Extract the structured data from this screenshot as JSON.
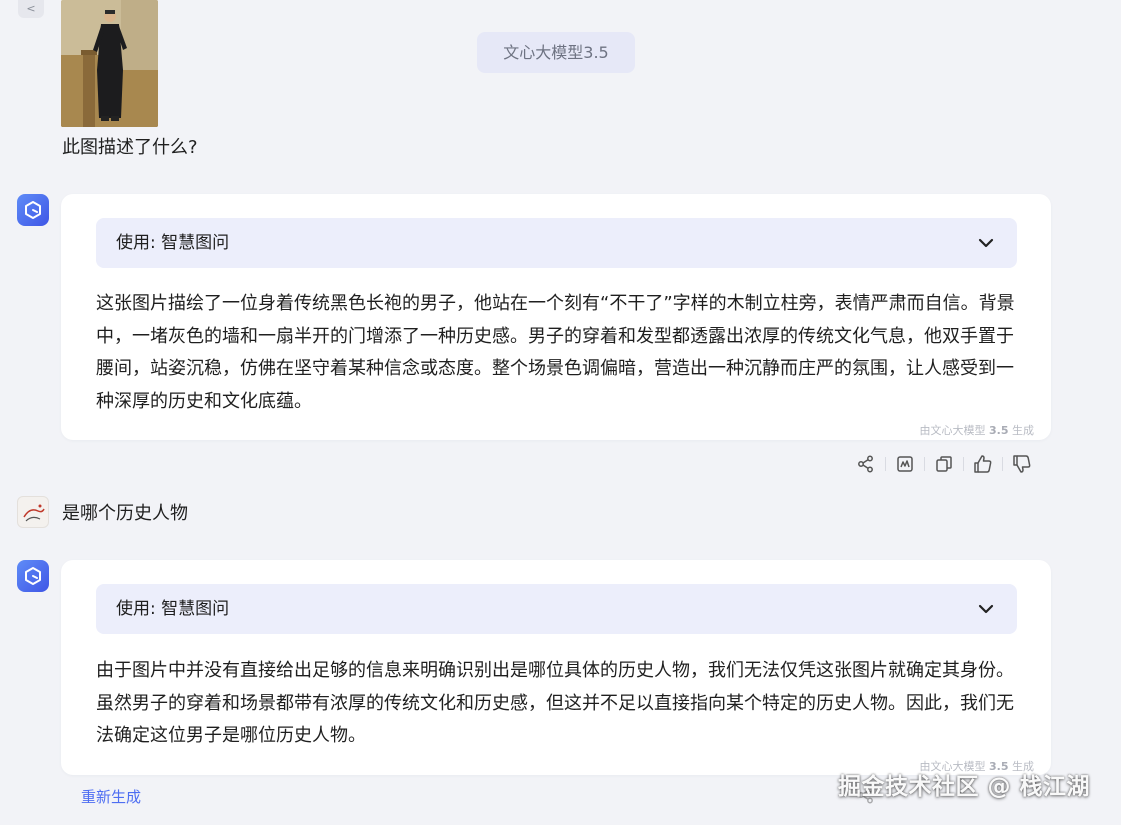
{
  "nav": {
    "back_label": "<"
  },
  "header": {
    "model_label": "文心大模型3.5"
  },
  "conversation": {
    "user_question_1": "此图描述了什么?",
    "bot_reply_1": {
      "tool_label": "使用: 智慧图问",
      "text": "这张图片描绘了一位身着传统黑色长袍的男子，他站在一个刻有“不干了”字样的木制立柱旁，表情严肃而自信。背景中，一堵灰色的墙和一扇半开的门增添了一种历史感。男子的穿着和发型都透露出浓厚的传统文化气息，他双手置于腰间，站姿沉稳，仿佛在坚守着某种信念或态度。整个场景色调偏暗，营造出一种沉静而庄严的氛围，让人感受到一种深厚的历史和文化底蕴。",
      "gen_prefix": "由文心大模型 ",
      "gen_version": "3.5",
      "gen_suffix": " 生成"
    },
    "user_question_2": "是哪个历史人物",
    "bot_reply_2": {
      "tool_label": "使用: 智慧图问",
      "text": "由于图片中并没有直接给出足够的信息来明确识别出是哪位具体的历史人物，我们无法仅凭这张图片就确定其身份。虽然男子的穿着和场景都带有浓厚的传统文化和历史感，但这并不足以直接指向某个特定的历史人物。因此，我们无法确定这位男子是哪位历史人物。",
      "gen_prefix": "由文心大模型 ",
      "gen_version": "3.5",
      "gen_suffix": " 生成"
    }
  },
  "actions": {
    "icons": [
      "share-icon",
      "chart-icon",
      "copy-icon",
      "thumbs-up-icon",
      "thumbs-down-icon"
    ]
  },
  "footer": {
    "regenerate_label": "重新生成"
  },
  "watermark": {
    "text": "掘金技术社区 @ 栈江湖"
  },
  "colors": {
    "page_bg": "#f2f3f7",
    "card_bg": "#ffffff",
    "tool_bar_bg": "#eceefb",
    "chip_bg": "#e6e8f7",
    "accent": "#4e6ef2",
    "avatar_gradient_start": "#5f8cf7",
    "avatar_gradient_end": "#3f56e6"
  }
}
